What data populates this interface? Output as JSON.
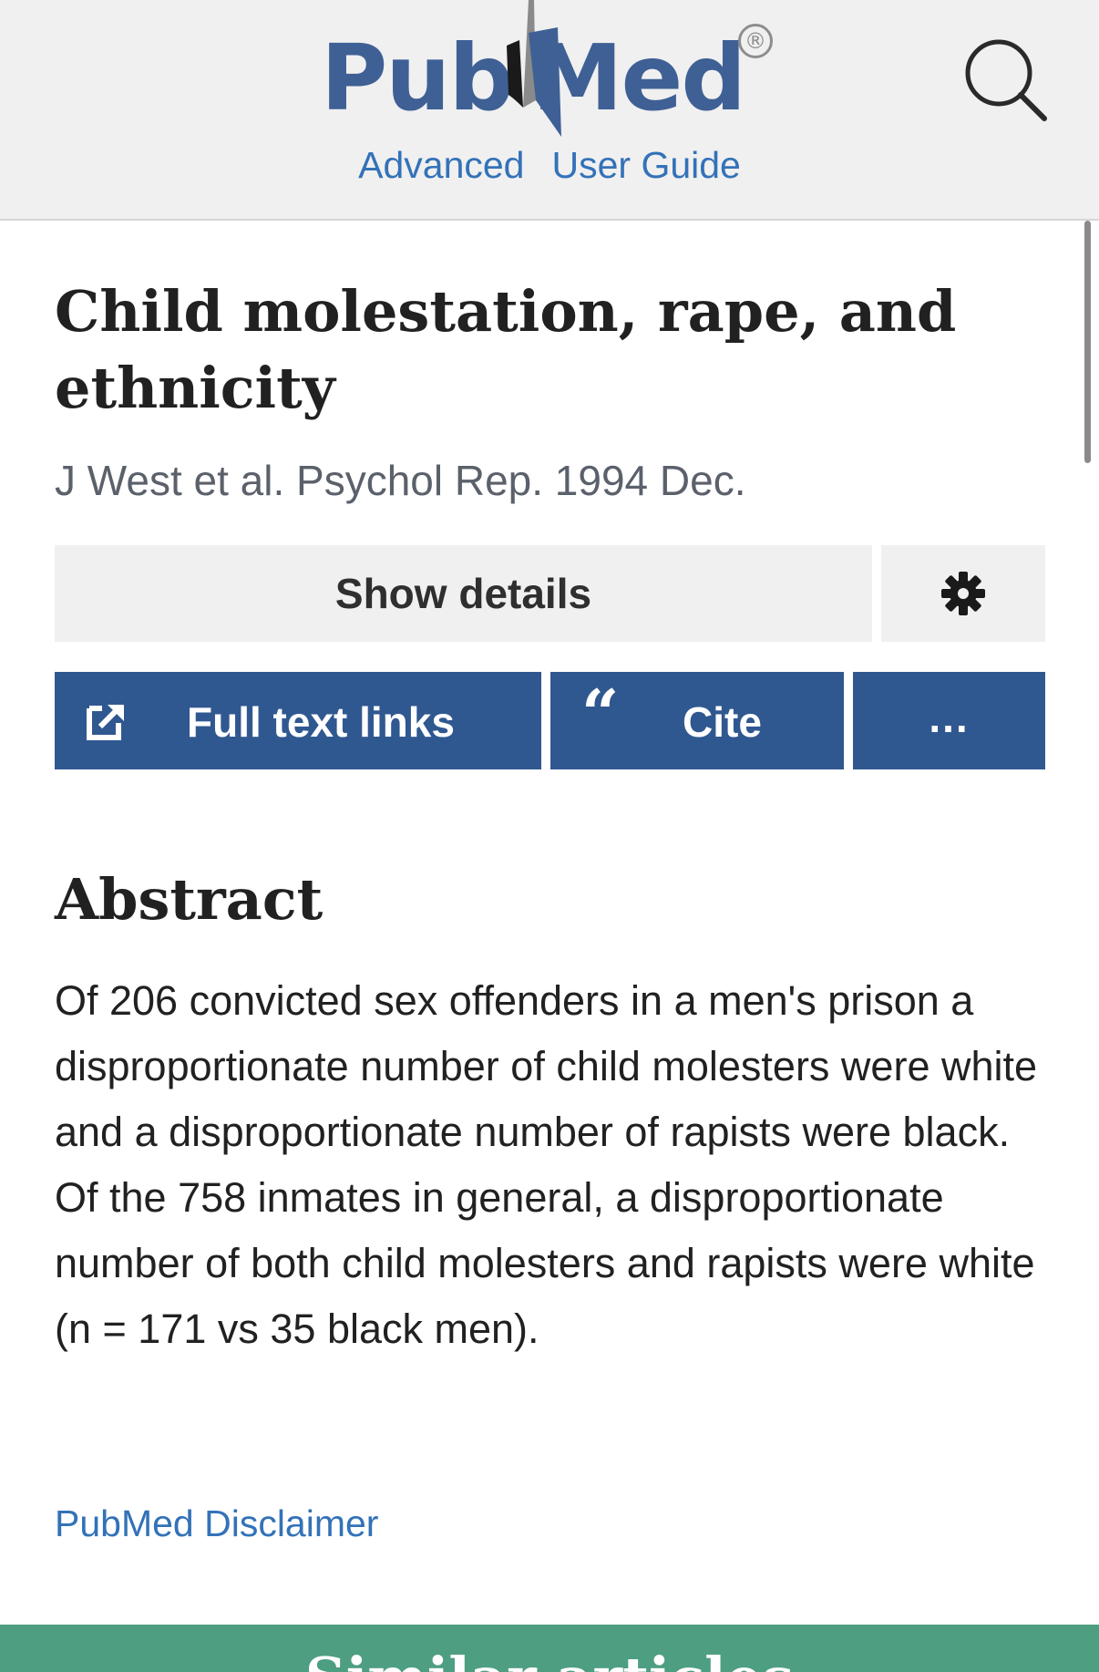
{
  "header": {
    "logo": {
      "part1": "Pub",
      "part2": "Med",
      "registered": "®"
    },
    "links": {
      "advanced": "Advanced",
      "user_guide": "User Guide"
    },
    "icons": {
      "search": "search-icon"
    }
  },
  "article": {
    "title": "Child molestation, rape, and ethnicity",
    "citation": "J West et al. Psychol Rep. 1994 Dec.",
    "show_details": "Show details",
    "actions": {
      "full_text": "Full text links",
      "cite_quote": "“",
      "cite": "Cite",
      "more": "..."
    },
    "abstract_heading": "Abstract",
    "abstract_text": "Of 206 convicted sex offenders in a men's prison a disproportionate number of child molesters were white and a disproportionate number of rapists were black. Of the 758 inmates in general, a disproportionate number of both child molesters and rapists were white (n = 171 vs 35 black men).",
    "disclaimer": "PubMed Disclaimer"
  },
  "similar_articles": {
    "heading": "Similar articles"
  },
  "colors": {
    "header_bg": "#f0f0f0",
    "logo_blue": "#3f6095",
    "link_blue": "#3372b8",
    "action_blue": "#305890",
    "similar_green": "#4e9e82"
  }
}
